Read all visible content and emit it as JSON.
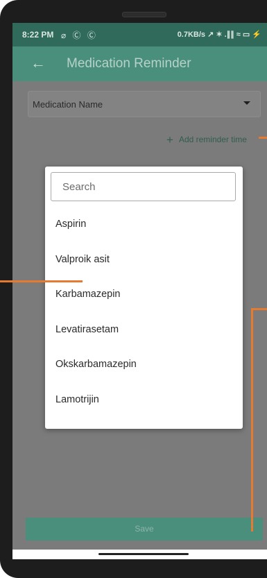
{
  "status_bar": {
    "time": "8:22 PM",
    "left_icons": "⌀ Ⓒ Ⓒ",
    "right_info": "0.7KB/s ↗ ✶ .∥∥ ≈ ▭ ⚡"
  },
  "app_bar": {
    "back_icon": "arrow-left",
    "title": "Medication Reminder"
  },
  "form": {
    "medication_select_label": "Medication Name",
    "add_reminder_plus": "+",
    "add_reminder_label": "Add reminder time",
    "save_label": "Save"
  },
  "dialog": {
    "search_placeholder": "Search",
    "items": [
      "Aspirin",
      "Valproik asit",
      "Karbamazepin",
      "Levatirasetam",
      "Okskarbamazepin",
      "Lamotrijin"
    ]
  },
  "colors": {
    "primary": "#4a8e7c",
    "status_bar": "#2f6a5a",
    "callout": "#e67a2e"
  }
}
